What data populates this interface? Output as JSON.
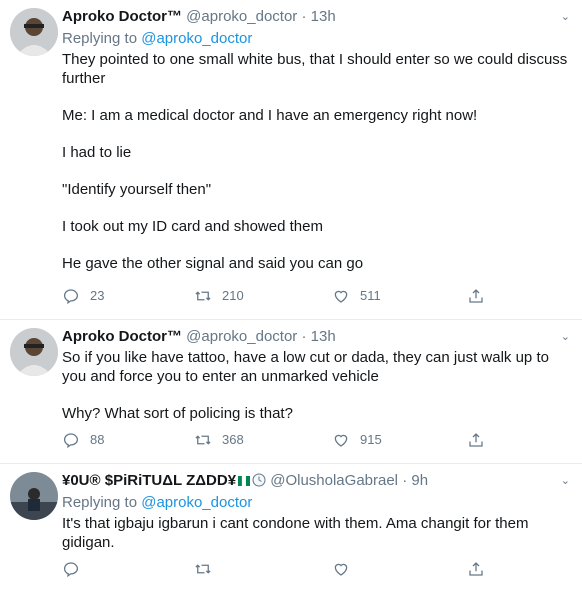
{
  "tweets": [
    {
      "name": "Aproko Doctor™",
      "handle": "@aproko_doctor",
      "dot": "·",
      "time": "13h",
      "reply_prefix": "Replying to ",
      "reply_to": "@aproko_doctor",
      "paragraphs": [
        "They pointed to one small white bus, that I should enter so we could discuss further",
        "Me: I am a medical doctor and I have an emergency right now!",
        "I had to lie",
        "\"Identify yourself then\"",
        "I took out my ID card and showed them",
        "He gave the other signal and said you can go"
      ],
      "replies": "23",
      "retweets": "210",
      "likes": "511"
    },
    {
      "name": "Aproko Doctor™",
      "handle": "@aproko_doctor",
      "dot": "·",
      "time": "13h",
      "paragraphs": [
        "So if you like have tattoo, have a low cut or dada, they can just walk up to you and force you to enter an unmarked vehicle",
        "Why? What sort of policing is that?"
      ],
      "replies": "88",
      "retweets": "368",
      "likes": "915"
    },
    {
      "name": "¥0U® $PiRiTUΔL ZΔDD¥",
      "handle": "@OlusholaGabrael",
      "dot": "·",
      "time": "9h",
      "reply_prefix": "Replying to ",
      "reply_to": "@aproko_doctor",
      "paragraphs": [
        "It's  that igbaju igbarun i cant condone with them. Ama changit for them gidigan."
      ]
    }
  ],
  "icons": {
    "reply": "reply-icon",
    "retweet": "retweet-icon",
    "like": "heart-icon",
    "share": "share-icon",
    "more": "chevron-down-icon"
  },
  "colors": {
    "text": "#14171a",
    "muted": "#657786",
    "link": "#1b95e0",
    "divider": "#e6ecf0"
  }
}
